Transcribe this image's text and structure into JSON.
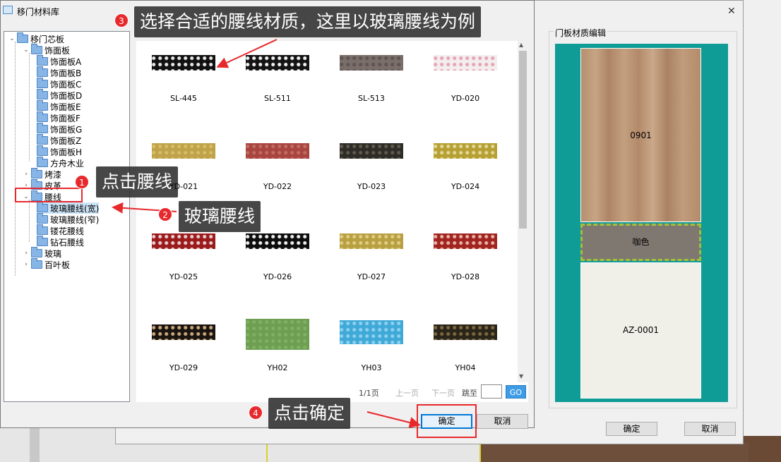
{
  "back_dialog": {
    "group_title": "门板材质编辑",
    "panels": [
      "0901",
      "咖色",
      "AZ-0001"
    ],
    "ok": "确定",
    "cancel": "取消",
    "close": "✕"
  },
  "dialog": {
    "title": "移门材料库",
    "close": "✕"
  },
  "tree": [
    {
      "label": "移门芯板",
      "level": 0,
      "toggle": "⌄"
    },
    {
      "label": "饰面板",
      "level": 1,
      "toggle": "⌄"
    },
    {
      "label": "饰面板A",
      "level": 2
    },
    {
      "label": "饰面板B",
      "level": 2
    },
    {
      "label": "饰面板C",
      "level": 2
    },
    {
      "label": "饰面板D",
      "level": 2
    },
    {
      "label": "饰面板E",
      "level": 2
    },
    {
      "label": "饰面板F",
      "level": 2
    },
    {
      "label": "饰面板G",
      "level": 2
    },
    {
      "label": "饰面板Z",
      "level": 2
    },
    {
      "label": "饰面板H",
      "level": 2
    },
    {
      "label": "方舟木业",
      "level": 2
    },
    {
      "label": "烤漆",
      "level": 1,
      "toggle": "›"
    },
    {
      "label": "皮革",
      "level": 1,
      "toggle": "›"
    },
    {
      "label": "腰线",
      "level": 1,
      "toggle": "⌄"
    },
    {
      "label": "玻璃腰线(宽)",
      "level": 2,
      "selected": true
    },
    {
      "label": "玻璃腰线(窄)",
      "level": 2
    },
    {
      "label": "镂花腰线",
      "level": 2
    },
    {
      "label": "钻石腰线",
      "level": 2
    },
    {
      "label": "玻璃",
      "level": 1,
      "toggle": "›"
    },
    {
      "label": "百叶板",
      "level": 1,
      "toggle": "›"
    }
  ],
  "materials": [
    {
      "code": "SL-445",
      "color": "#111111",
      "accent": "#e8e8e8"
    },
    {
      "code": "SL-511",
      "color": "#141414",
      "accent": "#f2f2f2"
    },
    {
      "code": "SL-513",
      "color": "#7a6e6b",
      "accent": "#5e5350"
    },
    {
      "code": "YD-020",
      "color": "#f3eeee",
      "accent": "#e7a3b3"
    },
    {
      "code": "YD-021",
      "color": "#bfa24a",
      "accent": "#d6bd68"
    },
    {
      "code": "YD-022",
      "color": "#a9443f",
      "accent": "#c06d63"
    },
    {
      "code": "YD-023",
      "color": "#2e2c27",
      "accent": "#5f5b4c"
    },
    {
      "code": "YD-024",
      "color": "#b6a033",
      "accent": "#e3d89a"
    },
    {
      "code": "YD-025",
      "color": "#9b1b1d",
      "accent": "#e6d0cf"
    },
    {
      "code": "YD-026",
      "color": "#0d0d0d",
      "accent": "#f0f0f0"
    },
    {
      "code": "YD-027",
      "color": "#b8a042",
      "accent": "#e0cd84"
    },
    {
      "code": "YD-028",
      "color": "#a2231f",
      "accent": "#e3b6a6"
    },
    {
      "code": "YD-029",
      "color": "#1a1410",
      "accent": "#c9a97c"
    },
    {
      "code": "YH02",
      "color": "#6d9e52",
      "accent": "#7fb063"
    },
    {
      "code": "YH03",
      "color": "#3fa9d8",
      "accent": "#8fd0ee"
    },
    {
      "code": "YH04",
      "color": "#2a241a",
      "accent": "#7c6a3c"
    }
  ],
  "pager": {
    "count": "1/1页",
    "prev": "上一页",
    "next": "下一页",
    "jump": "跳至",
    "go": "GO"
  },
  "buttons": {
    "ok": "确定",
    "cancel": "取消"
  },
  "annotations": {
    "step1": {
      "num": "1",
      "text": "点击腰线"
    },
    "step2": {
      "num": "2",
      "text": "玻璃腰线"
    },
    "step3": {
      "num": "3",
      "text": "选择合适的腰线材质，这里以玻璃腰线为例"
    },
    "step4": {
      "num": "4",
      "text": "点击确定"
    }
  },
  "colors": {
    "annotation_red": "#e8292c",
    "accent_blue": "#0078d7",
    "preview_bg": "#0f9b96"
  }
}
